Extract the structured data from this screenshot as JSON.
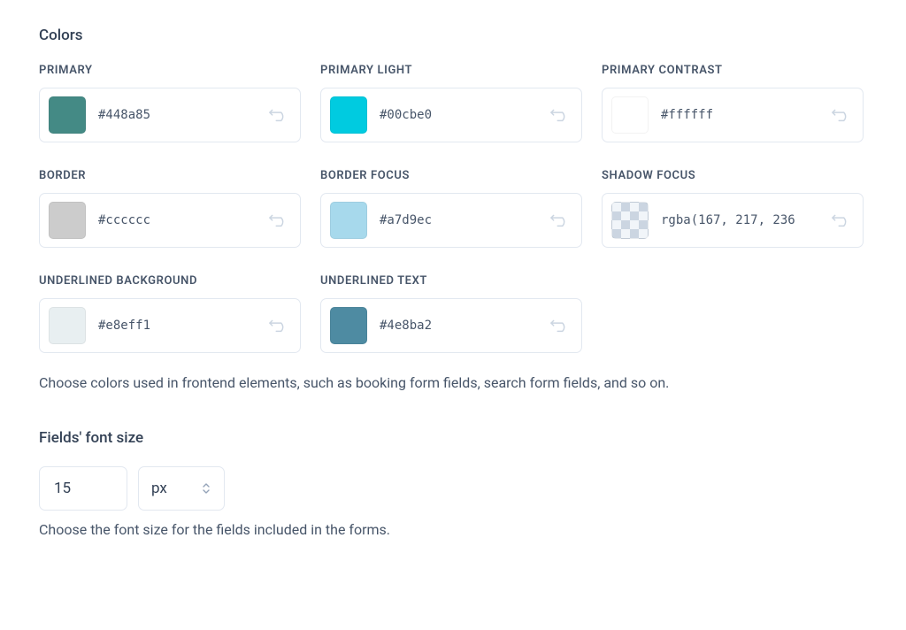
{
  "colors": {
    "title": "Colors",
    "help": "Choose colors used in frontend elements, such as booking form fields, search form fields, and so on.",
    "items": [
      {
        "label": "PRIMARY",
        "value": "#448a85",
        "swatch": "#448a85",
        "transparent": false
      },
      {
        "label": "PRIMARY LIGHT",
        "value": "#00cbe0",
        "swatch": "#00cbe0",
        "transparent": false
      },
      {
        "label": "PRIMARY CONTRAST",
        "value": "#ffffff",
        "swatch": "#ffffff",
        "transparent": false
      },
      {
        "label": "BORDER",
        "value": "#cccccc",
        "swatch": "#cccccc",
        "transparent": false
      },
      {
        "label": "BORDER FOCUS",
        "value": "#a7d9ec",
        "swatch": "#a7d9ec",
        "transparent": false
      },
      {
        "label": "SHADOW FOCUS",
        "value": "rgba(167, 217, 236",
        "swatch": "rgba(167,217,236,0.5)",
        "transparent": true
      },
      {
        "label": "UNDERLINED BACKGROUND",
        "value": "#e8eff1",
        "swatch": "#e8eff1",
        "transparent": false
      },
      {
        "label": "UNDERLINED TEXT",
        "value": "#4e8ba2",
        "swatch": "#4e8ba2",
        "transparent": false
      }
    ]
  },
  "fontSize": {
    "title": "Fields' font size",
    "value": "15",
    "unit": "px",
    "help": "Choose the font size for the fields included in the forms."
  }
}
